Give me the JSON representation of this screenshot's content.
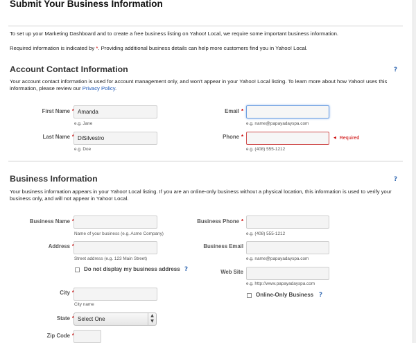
{
  "page_title": "Submit Your Business Information",
  "intro": {
    "line1": "To set up your Marketing Dashboard and to create a free business listing on Yahoo! Local, we require some important business information.",
    "line2_before": "Required information is indicated by ",
    "line2_star": "*",
    "line2_after": ". Providing additional business details can help more customers find you in Yahoo! Local."
  },
  "account": {
    "heading": "Account Contact Information",
    "help": "?",
    "desc": "Your account contact information is used for account management only, and won't appear in your Yahoo! Local listing. To learn more about how Yahoo! uses this information, please review our ",
    "link": "Privacy Policy",
    "desc_end": ".",
    "first_name": {
      "label": "First Name",
      "star": "*",
      "value": "Amanda",
      "hint": "e.g. Jane"
    },
    "last_name": {
      "label": "Last Name",
      "star": "*",
      "value": "DiSilvestro",
      "hint": "e.g. Doe"
    },
    "email": {
      "label": "Email",
      "star": "*",
      "value": "",
      "hint": "e.g. name@papayadayspa.com"
    },
    "phone": {
      "label": "Phone",
      "star": "*",
      "value": "",
      "hint": "e.g. (408) 555-1212",
      "error": "Required",
      "error_arrow": "◀"
    }
  },
  "business": {
    "heading": "Business Information",
    "help": "?",
    "desc": "Your business information appears in your Yahoo! Local listing. If you are an online-only business without a physical location, this information is used to verify your business only, and will not appear in Yahoo! Local.",
    "name": {
      "label": "Business Name",
      "star": "*",
      "value": "",
      "hint": "Name of your business (e.g. Acme Company)"
    },
    "address": {
      "label": "Address",
      "star": "*",
      "value": "",
      "hint": "Street address (e.g. 123 Main Street)"
    },
    "hide_address": {
      "label": "Do not display my business address",
      "help": "?"
    },
    "city": {
      "label": "City",
      "star": "*",
      "value": "",
      "hint": "City name"
    },
    "state": {
      "label": "State",
      "star": "*",
      "value": "Select One",
      "chev_up": "▲",
      "chev_down": "▼"
    },
    "zip": {
      "label": "Zip Code",
      "star": "*",
      "value": ""
    },
    "phone": {
      "label": "Business Phone",
      "star": "*",
      "value": "",
      "hint": "e.g. (408) 555-1212"
    },
    "email": {
      "label": "Business Email",
      "value": "",
      "hint": "e.g. name@papayadayspa.com"
    },
    "website": {
      "label": "Web Site",
      "value": "",
      "hint": "e.g. http://www.papayadayspa.com"
    },
    "online_only": {
      "label": "Online-Only Business",
      "help": "?"
    }
  }
}
